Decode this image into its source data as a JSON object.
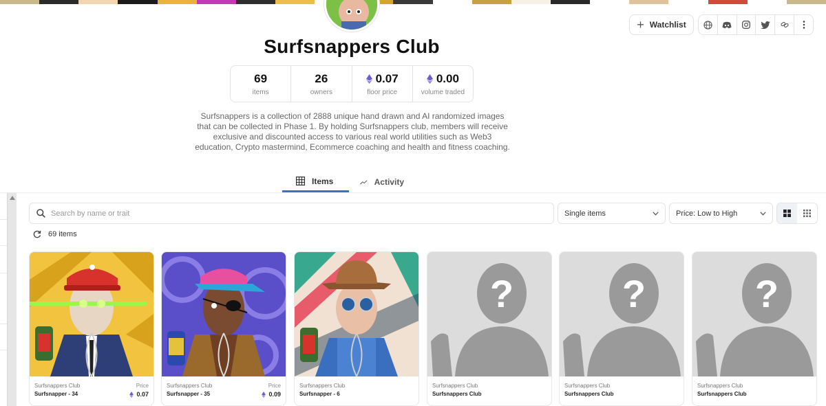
{
  "collection": {
    "title": "Surfsnappers Club",
    "description": "Surfsnappers is a collection of 2888 unique hand drawn and AI randomized images that can be collected in Phase 1. By holding Surfsnappers club, members will receive exclusive and discounted access to various real world utilities such as Web3 education, Crypto mastermind, Ecommerce coaching and health and fitness coaching."
  },
  "actions": {
    "watchlist_label": "Watchlist",
    "socials": [
      "website-icon",
      "discord-icon",
      "instagram-icon",
      "twitter-icon",
      "link-icon",
      "more-icon"
    ]
  },
  "stats": [
    {
      "value": "69",
      "label": "items",
      "eth": false
    },
    {
      "value": "26",
      "label": "owners",
      "eth": false
    },
    {
      "value": "0.07",
      "label": "floor price",
      "eth": true
    },
    {
      "value": "0.00",
      "label": "volume traded",
      "eth": true
    }
  ],
  "tabs": [
    {
      "label": "Items",
      "icon": "grid-icon",
      "active": true
    },
    {
      "label": "Activity",
      "icon": "activity-line-icon",
      "active": false
    }
  ],
  "filters": {
    "search_placeholder": "Search by name or trait",
    "type_select": "Single items",
    "sort_select": "Price: Low to High",
    "count_label": "69 items"
  },
  "cards": [
    {
      "collection": "Surfsnappers Club",
      "name": "Surfsnapper - 34",
      "price_label": "Price",
      "price": "0.07",
      "art": "surfer-red-cap"
    },
    {
      "collection": "Surfsnappers Club",
      "name": "Surfsnapper - 35",
      "price_label": "Price",
      "price": "0.09",
      "art": "surfer-pink-cap"
    },
    {
      "collection": "Surfsnappers Club",
      "name": "Surfsnapper - 6",
      "price_label": "",
      "price": "",
      "art": "surfer-cowboy-hat"
    },
    {
      "collection": "Surfsnappers Club",
      "name": "Surfsnappers Club",
      "price_label": "",
      "price": "",
      "art": "placeholder"
    },
    {
      "collection": "Surfsnappers Club",
      "name": "Surfsnappers Club",
      "price_label": "",
      "price": "",
      "art": "placeholder"
    },
    {
      "collection": "Surfsnappers Club",
      "name": "Surfsnappers Club",
      "price_label": "",
      "price": "",
      "art": "placeholder"
    }
  ],
  "colors": {
    "accent": "#3a70c8",
    "eth": "#6b5fd3",
    "border": "#e3e3e3",
    "placeholder_bg": "#dcdcdc",
    "placeholder_fg": "#9a9a9a"
  }
}
